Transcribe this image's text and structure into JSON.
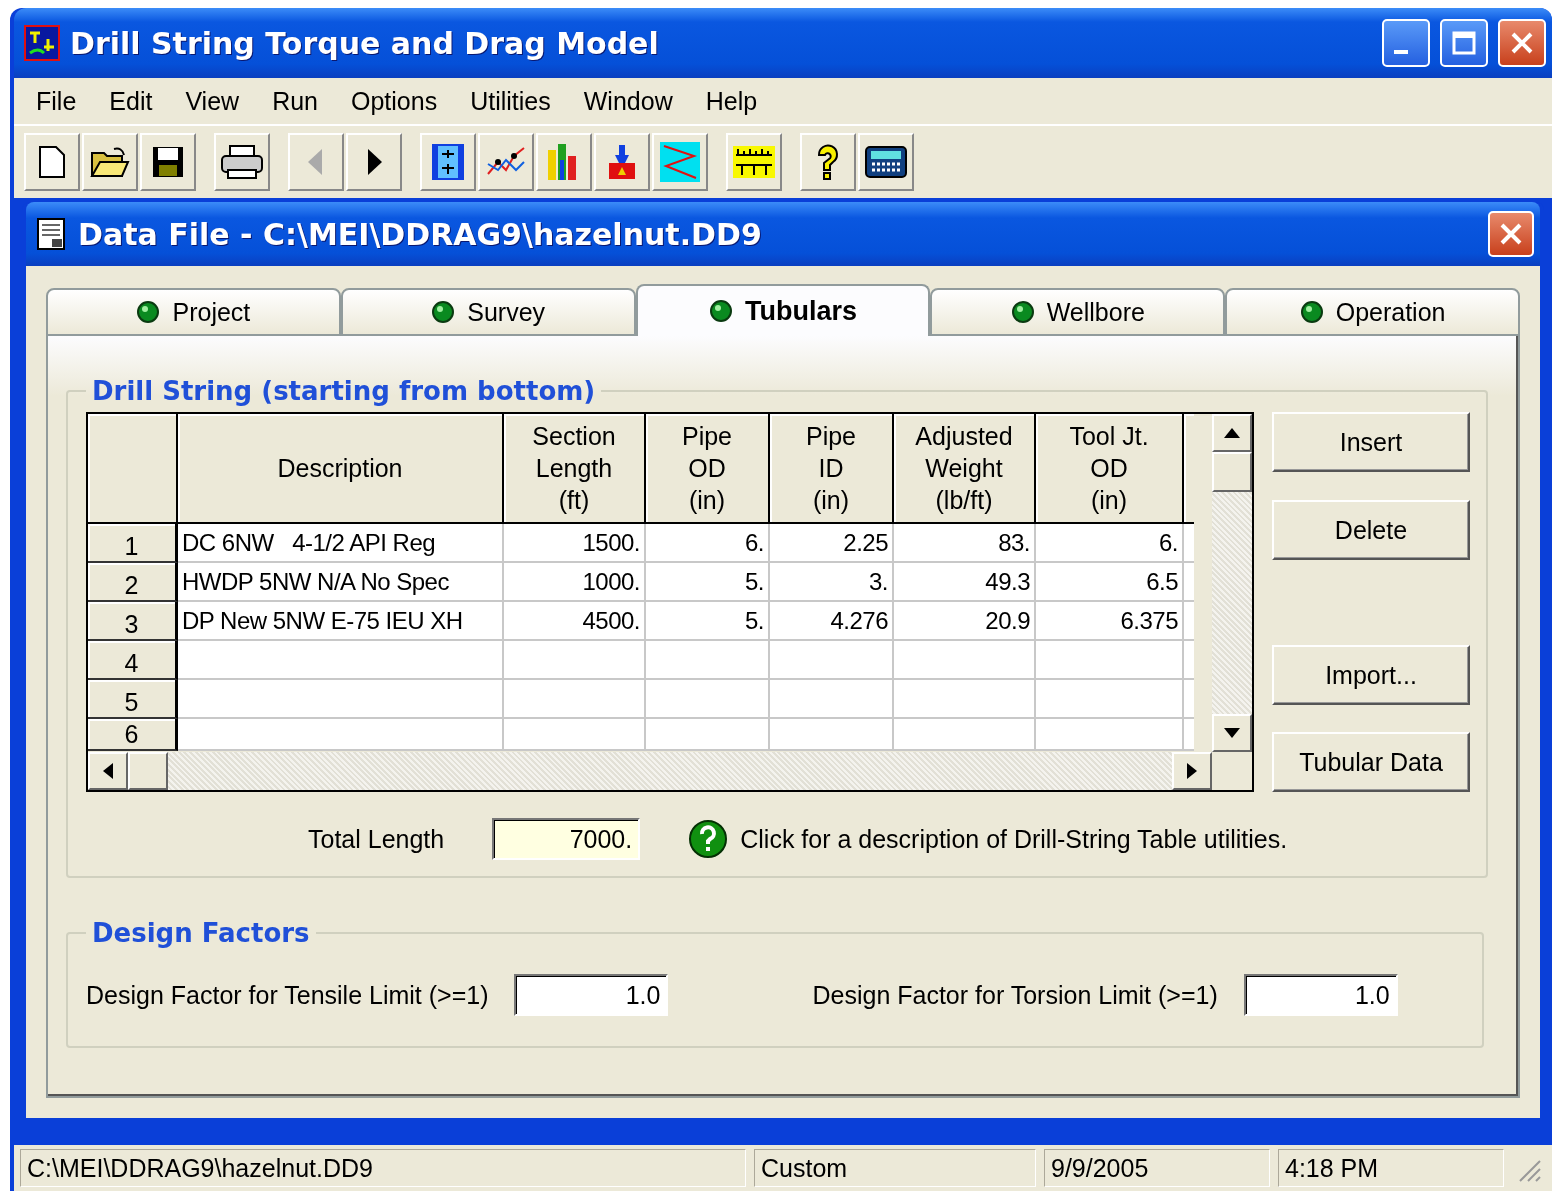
{
  "window": {
    "title": "Drill String Torque and Drag Model"
  },
  "menu": [
    "File",
    "Edit",
    "View",
    "Run",
    "Options",
    "Utilities",
    "Window",
    "Help"
  ],
  "child_window": {
    "title": "Data File - C:\\MEI\\DDRAG9\\hazelnut.DD9"
  },
  "tabs": [
    {
      "label": "Project",
      "selected": false
    },
    {
      "label": "Survey",
      "selected": false
    },
    {
      "label": "Tubulars",
      "selected": true
    },
    {
      "label": "Wellbore",
      "selected": false
    },
    {
      "label": "Operation",
      "selected": false
    }
  ],
  "drill_string": {
    "title": "Drill String (starting from bottom)",
    "columns": [
      "Description",
      "Section\nLength\n(ft)",
      "Pipe\nOD\n(in)",
      "Pipe\nID\n(in)",
      "Adjusted\nWeight\n(lb/ft)",
      "Tool Jt.\nOD\n(in)"
    ],
    "rows": [
      {
        "number": "1",
        "cells": [
          "DC 6NW   4-1/2 API Reg",
          "1500.",
          "6.",
          "2.25",
          "83.",
          "6."
        ]
      },
      {
        "number": "2",
        "cells": [
          "HWDP 5NW N/A No Spec",
          "1000.",
          "5.",
          "3.",
          "49.3",
          "6.5"
        ]
      },
      {
        "number": "3",
        "cells": [
          "DP New 5NW E-75 IEU XH",
          "4500.",
          "5.",
          "4.276",
          "20.9",
          "6.375"
        ]
      },
      {
        "number": "4",
        "cells": []
      },
      {
        "number": "5",
        "cells": []
      },
      {
        "number": "6",
        "cells": []
      }
    ],
    "buttons": [
      "Insert",
      "Delete",
      "Import...",
      "Tubular Data"
    ],
    "total_length": {
      "label": "Total Length",
      "value": "7000."
    },
    "help_text": "Click for a description of Drill-String Table utilities."
  },
  "design_factors": {
    "title": "Design Factors",
    "fields": [
      {
        "label": "Design Factor for Tensile Limit (>=1)",
        "value": "1.0"
      },
      {
        "label": "Design Factor for Torsion Limit (>=1)",
        "value": "1.0"
      }
    ]
  },
  "status_bar": [
    "C:\\MEI\\DDRAG9\\hazelnut.DD9",
    "Custom",
    "9/9/2005",
    "4:18 PM"
  ]
}
